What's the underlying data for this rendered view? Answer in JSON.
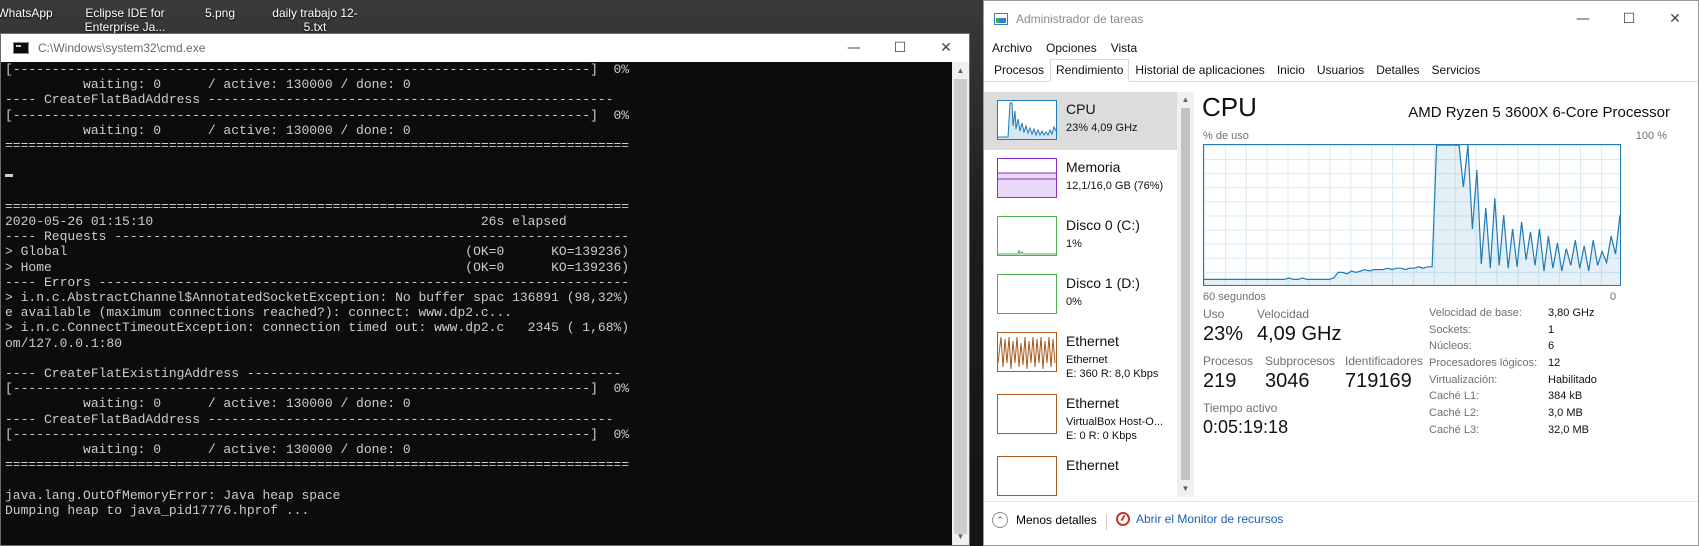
{
  "desktop": {
    "icons": [
      "WhatsApp",
      "Eclipse IDE for Enterprise Ja...",
      "5.png",
      "daily trabajo 12-5.txt"
    ]
  },
  "cmd": {
    "title": "C:\\Windows\\system32\\cmd.exe",
    "lines": [
      "[--------------------------------------------------------------------------]  0%",
      "          waiting: 0      / active: 130000 / done: 0",
      "---- CreateFlatBadAddress ----------------------------------------------------",
      "[--------------------------------------------------------------------------]  0%",
      "          waiting: 0      / active: 130000 / done: 0",
      "================================================================================",
      "",
      "",
      "",
      "================================================================================",
      "2020-05-26 01:15:10                                          26s elapsed",
      "---- Requests ------------------------------------------------------------------",
      "> Global                                                   (OK=0      KO=139236)",
      "> Home                                                     (OK=0      KO=139236)",
      "---- Errors --------------------------------------------------------------------",
      "> i.n.c.AbstractChannel$AnnotatedSocketException: No buffer spac 136891 (98,32%)",
      "e available (maximum connections reached?): connect: www.dp2.c...",
      "> i.n.c.ConnectTimeoutException: connection timed out: www.dp2.c   2345 ( 1,68%)",
      "om/127.0.0.1:80",
      "",
      "---- CreateFlatExistingAddress ------------------------------------------------",
      "[--------------------------------------------------------------------------]  0%",
      "          waiting: 0      / active: 130000 / done: 0",
      "---- CreateFlatBadAddress ----------------------------------------------------",
      "[--------------------------------------------------------------------------]  0%",
      "          waiting: 0      / active: 130000 / done: 0",
      "================================================================================",
      "",
      "java.lang.OutOfMemoryError: Java heap space",
      "Dumping heap to java_pid17776.hprof ..."
    ]
  },
  "taskmgr": {
    "title": "Administrador de tareas",
    "menu": [
      "Archivo",
      "Opciones",
      "Vista"
    ],
    "tabs": [
      "Procesos",
      "Rendimiento",
      "Historial de aplicaciones",
      "Inicio",
      "Usuarios",
      "Detalles",
      "Servicios"
    ],
    "active_tab": "Rendimiento",
    "items": [
      {
        "name": "CPU",
        "sub1": "23% 4,09 GHz",
        "sub2": "",
        "color": "#1f7bb5"
      },
      {
        "name": "Memoria",
        "sub1": "12,1/16,0 GB (76%)",
        "sub2": "",
        "color": "#8b2fc9"
      },
      {
        "name": "Disco 0 (C:)",
        "sub1": "1%",
        "sub2": "",
        "color": "#4caf50"
      },
      {
        "name": "Disco 1 (D:)",
        "sub1": "0%",
        "sub2": "",
        "color": "#4caf50"
      },
      {
        "name": "Ethernet",
        "sub1": "Ethernet",
        "sub2": "E: 360 R: 8,0 Kbps",
        "color": "#a7591e"
      },
      {
        "name": "Ethernet",
        "sub1": "VirtualBox Host-O...",
        "sub2": "E: 0 R: 0 Kbps",
        "color": "#a7591e"
      },
      {
        "name": "Ethernet",
        "sub1": "",
        "sub2": "",
        "color": "#a7591e"
      }
    ],
    "detail": {
      "title": "CPU",
      "processor": "AMD Ryzen 5 3600X 6-Core Processor",
      "y_label": "% de uso",
      "y_max": "100 %",
      "x_left": "60 segundos",
      "x_right": "0",
      "stats": {
        "uso_label": "Uso",
        "uso": "23%",
        "vel_label": "Velocidad",
        "vel": "4,09 GHz",
        "proc_label": "Procesos",
        "proc": "219",
        "sub_label": "Subprocesos",
        "sub": "3046",
        "id_label": "Identificadores",
        "id": "719169",
        "time_label": "Tiempo activo",
        "time": "0:05:19:18"
      },
      "kv": [
        [
          "Velocidad de base:",
          "3,80 GHz"
        ],
        [
          "Sockets:",
          "1"
        ],
        [
          "Núcleos:",
          "6"
        ],
        [
          "Procesadores lógicos:",
          "12"
        ],
        [
          "Virtualización:",
          "Habilitado"
        ],
        [
          "Caché L1:",
          "384 kB"
        ],
        [
          "Caché L2:",
          "3,0 MB"
        ],
        [
          "Caché L3:",
          "32,0 MB"
        ]
      ],
      "usage_history": [
        4,
        4,
        4,
        4,
        4,
        4,
        4,
        4,
        4,
        4,
        4,
        4,
        4,
        4,
        4,
        4,
        4,
        4,
        4,
        5,
        4,
        4,
        5,
        4,
        4,
        4,
        4,
        4,
        4,
        5,
        9,
        9,
        8,
        10,
        9,
        10,
        11,
        10,
        11,
        11,
        11,
        12,
        11,
        12,
        12,
        11,
        12,
        12,
        13,
        12,
        13,
        13,
        100,
        100,
        100,
        100,
        100,
        100,
        70,
        100,
        40,
        82,
        15,
        55,
        12,
        62,
        14,
        50,
        12,
        40,
        13,
        45,
        18,
        38,
        14,
        40,
        10,
        35,
        12,
        30,
        10,
        26,
        14,
        32,
        12,
        28,
        10,
        32,
        14,
        24,
        16,
        35,
        22,
        50
      ]
    },
    "footer": {
      "less": "Menos detalles",
      "monitor": "Abrir el Monitor de recursos"
    }
  }
}
